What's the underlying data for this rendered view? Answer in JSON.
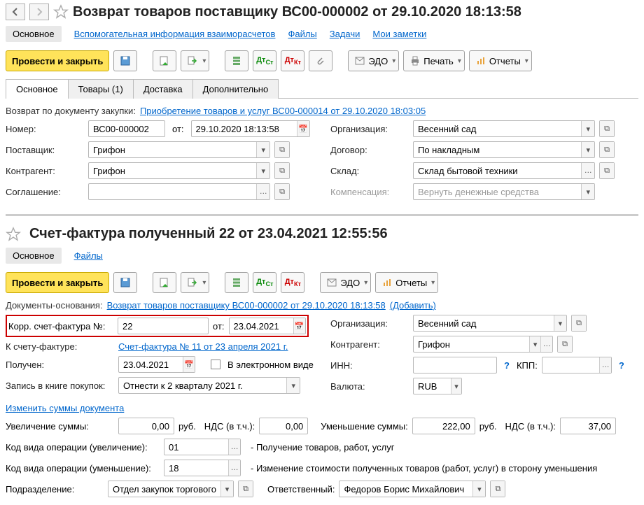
{
  "section1": {
    "title": "Возврат товаров поставщику ВС00-000002 от 29.10.2020 18:13:58",
    "topnav": {
      "main": "Основное",
      "aux": "Вспомогательная информация взаиморасчетов",
      "files": "Файлы",
      "tasks": "Задачи",
      "notes": "Мои заметки"
    },
    "toolbar": {
      "post_close": "Провести и закрыть",
      "edo": "ЭДО",
      "print": "Печать",
      "reports": "Отчеты"
    },
    "subtabs": {
      "main": "Основное",
      "goods": "Товары (1)",
      "delivery": "Доставка",
      "extra": "Дополнительно"
    },
    "basis_label": "Возврат по документу закупки:",
    "basis_link": "Приобретение товаров и услуг ВС00-000014 от 29.10.2020 18:03:05",
    "labels": {
      "number": "Номер:",
      "from": "от:",
      "org": "Организация:",
      "supplier": "Поставщик:",
      "contract": "Договор:",
      "counterparty": "Контрагент:",
      "warehouse": "Склад:",
      "agreement": "Соглашение:",
      "compensation": "Компенсация:"
    },
    "values": {
      "number": "ВС00-000002",
      "date": "29.10.2020 18:13:58",
      "org": "Весенний сад",
      "supplier": "Грифон",
      "contract": "По накладным",
      "counterparty": "Грифон",
      "warehouse": "Склад бытовой техники",
      "agreement": "",
      "compensation": "Вернуть денежные средства"
    }
  },
  "section2": {
    "title": "Счет-фактура полученный 22 от 23.04.2021 12:55:56",
    "topnav": {
      "main": "Основное",
      "files": "Файлы"
    },
    "toolbar": {
      "post_close": "Провести и закрыть",
      "edo": "ЭДО",
      "reports": "Отчеты"
    },
    "basis_label": "Документы-основания:",
    "basis_link": "Возврат товаров поставщику ВС00-000002 от 29.10.2020 18:13:58",
    "basis_add": "(Добавить)",
    "labels": {
      "corr": "Корр. счет-фактура №:",
      "from": "от:",
      "to_invoice": "К счету-фактуре:",
      "received": "Получен:",
      "electronic": "В электронном виде",
      "book": "Запись в книге покупок:",
      "org": "Организация:",
      "counterparty": "Контрагент:",
      "inn": "ИНН:",
      "kpp": "КПП:",
      "currency": "Валюта:",
      "change_sums": "Изменить суммы документа",
      "inc": "Увеличение суммы:",
      "rub": "руб.",
      "vat_incl": "НДС (в т.ч.):",
      "dec": "Уменьшение суммы:",
      "kvo_inc": "Код вида операции (увеличение):",
      "kvo_inc_desc": "- Получение товаров, работ, услуг",
      "kvo_dec": "Код вида операции (уменьшение):",
      "kvo_dec_desc": "- Изменение стоимости полученных товаров (работ, услуг) в сторону уменьшения",
      "dept": "Подразделение:",
      "responsible": "Ответственный:"
    },
    "values": {
      "corr_no": "22",
      "corr_date": "23.04.2021",
      "to_invoice_link": "Счет-фактура № 11 от 23 апреля 2021 г.",
      "received_date": "23.04.2021",
      "book": "Отнести к 2 кварталу 2021 г.",
      "org": "Весенний сад",
      "counterparty": "Грифон",
      "inn": "",
      "kpp": "",
      "currency": "RUB",
      "inc_sum": "0,00",
      "inc_vat": "0,00",
      "dec_sum": "222,00",
      "dec_vat": "37,00",
      "kvo_inc": "01",
      "kvo_dec": "18",
      "dept": "Отдел закупок торгового направления",
      "responsible": "Федоров Борис Михайлович"
    }
  }
}
